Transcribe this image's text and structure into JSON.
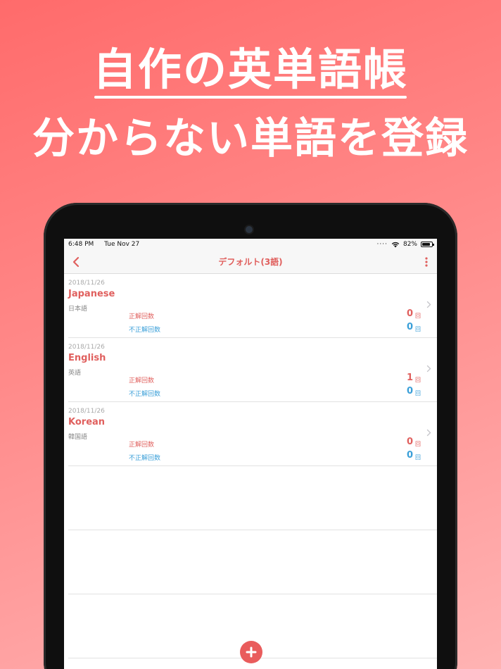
{
  "promo": {
    "headline_1": "自作の英単語帳",
    "headline_2": "分からない単語を登録"
  },
  "statusbar": {
    "time": "6:48 PM",
    "date": "Tue Nov 27",
    "battery": "82%",
    "battery_level": 0.82
  },
  "navbar": {
    "title": "デフォルト(3語)"
  },
  "words": [
    {
      "date": "2018/11/26",
      "word": "Japanese",
      "meaning": "日本語",
      "correct_label": "正解回数",
      "correct_count": "0",
      "incorrect_label": "不正解回数",
      "incorrect_count": "0",
      "unit": "回"
    },
    {
      "date": "2018/11/26",
      "word": "English",
      "meaning": "英語",
      "correct_label": "正解回数",
      "correct_count": "1",
      "incorrect_label": "不正解回数",
      "incorrect_count": "0",
      "unit": "回"
    },
    {
      "date": "2018/11/26",
      "word": "Korean",
      "meaning": "韓国語",
      "correct_label": "正解回数",
      "correct_count": "0",
      "incorrect_label": "不正解回数",
      "incorrect_count": "0",
      "unit": "回"
    }
  ],
  "colors": {
    "accent": "#e0605e",
    "incorrect": "#3a9fd8",
    "background_top": "#ff6b6b",
    "background_bottom": "#ffb3b3"
  },
  "icons": {
    "back": "chevron-left-icon",
    "more": "more-vertical-icon",
    "add": "plus-icon",
    "row_disclosure": "chevron-right-icon",
    "wifi": "wifi-icon",
    "battery": "battery-icon"
  }
}
